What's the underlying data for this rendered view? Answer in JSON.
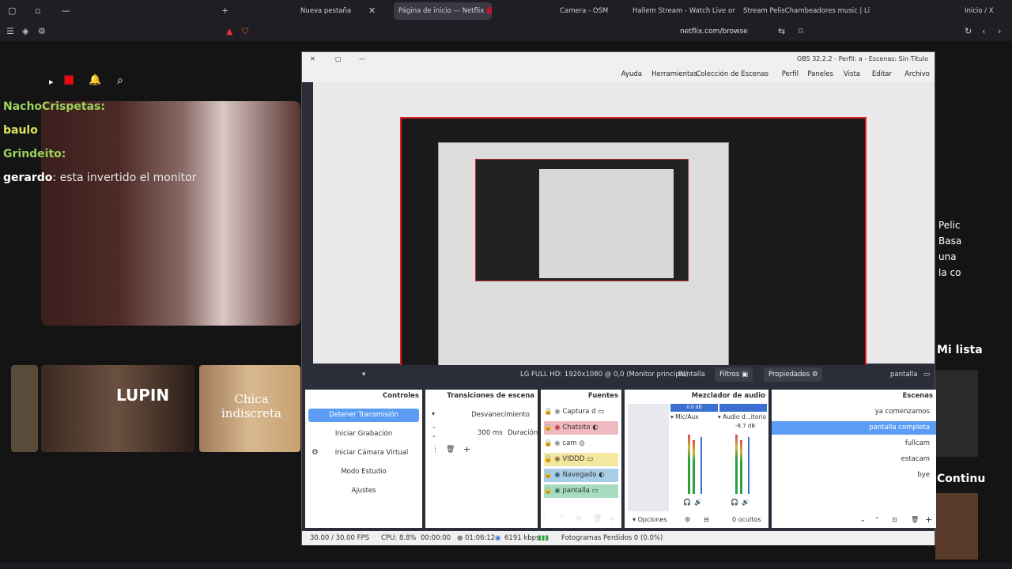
{
  "browser": {
    "tabs": [
      {
        "label": "Nueva pestaña",
        "active": false
      },
      {
        "label": "Página de inicio — Netflix",
        "active": true
      },
      {
        "label": "Camera - OSM",
        "active": false
      },
      {
        "label": "Hallem Stream - Watch Live on",
        "active": false
      },
      {
        "label": "Stream PelisChambeadores music | Lista",
        "active": false
      },
      {
        "label": "Inicio / X",
        "active": false
      }
    ],
    "url": "netflix.com/browse"
  },
  "chat": {
    "messages": [
      {
        "user": "NachoCrispetas:",
        "text": ""
      },
      {
        "user": "baulo",
        "text": ""
      },
      {
        "user": "Grindeito:",
        "text": ""
      },
      {
        "user": "gerardo",
        "text": ": esta invertido el monitor"
      }
    ]
  },
  "netflix": {
    "row_titles": [
      "LUPIN",
      "Chica indiscreta"
    ],
    "right_texts": [
      "Mi lista",
      "Continu",
      "Pelic",
      "Basa",
      "una",
      "la co"
    ]
  },
  "obs": {
    "title": "OBS 32.2.2 - Perfil: a - Escenas: Sin Título",
    "menu": [
      "Archivo",
      "Editar",
      "Vista",
      "Paneles",
      "Perfil",
      "Colección de Escenas",
      "Herramientas",
      "Ayuda"
    ],
    "source_bar": {
      "source_name": "pantalla",
      "properties_label": "Propiedades",
      "filters_label": "Filtros",
      "display_label": "Pantalla",
      "display_value": "LG FULL HD: 1920x1080 @ 0,0 (Monitor principal)"
    },
    "docks": {
      "scenes": {
        "title": "Escenas",
        "items": [
          "ya comenzamos",
          "pantalla completa",
          "fullcam",
          "estacam",
          "bye"
        ],
        "selected": 1
      },
      "audio_mixer": {
        "title": "Mezclador de audio",
        "channels": [
          {
            "name": "Audio d...itorio",
            "db": "-8.7 dB"
          },
          {
            "name": "Mic/Aux",
            "db": "0.0 dB"
          }
        ],
        "hidden_label": "0 ocultos"
      },
      "sources": {
        "title": "Fuentes",
        "items": [
          "Captura d",
          "Chatsito",
          "cam",
          "VIDDD",
          "Navegado",
          "pantalla"
        ]
      },
      "transitions": {
        "title": "Transiciones de escena",
        "type": "Desvanecimiento",
        "duration_label": "Duración",
        "duration_value": "300 ms"
      },
      "controls": {
        "title": "Controles",
        "buttons": [
          "Detener Transmisión",
          "Iniciar Grabación",
          "Iniciar Cámara Virtual",
          "Modo Estudio",
          "Ajustes"
        ]
      },
      "options_label": "Opciones"
    },
    "status": {
      "dropped": "Fotogramas Perdidos 0 (0.0%)",
      "bitrate": "6191 kbps",
      "live_time": "01:06:12",
      "rec_time": "00:00:00",
      "cpu": "CPU: 8.8%",
      "fps": "30.00 / 30.00 FPS"
    }
  },
  "colors": {
    "accent": "#5b9df5",
    "red_border": "#e02020"
  }
}
